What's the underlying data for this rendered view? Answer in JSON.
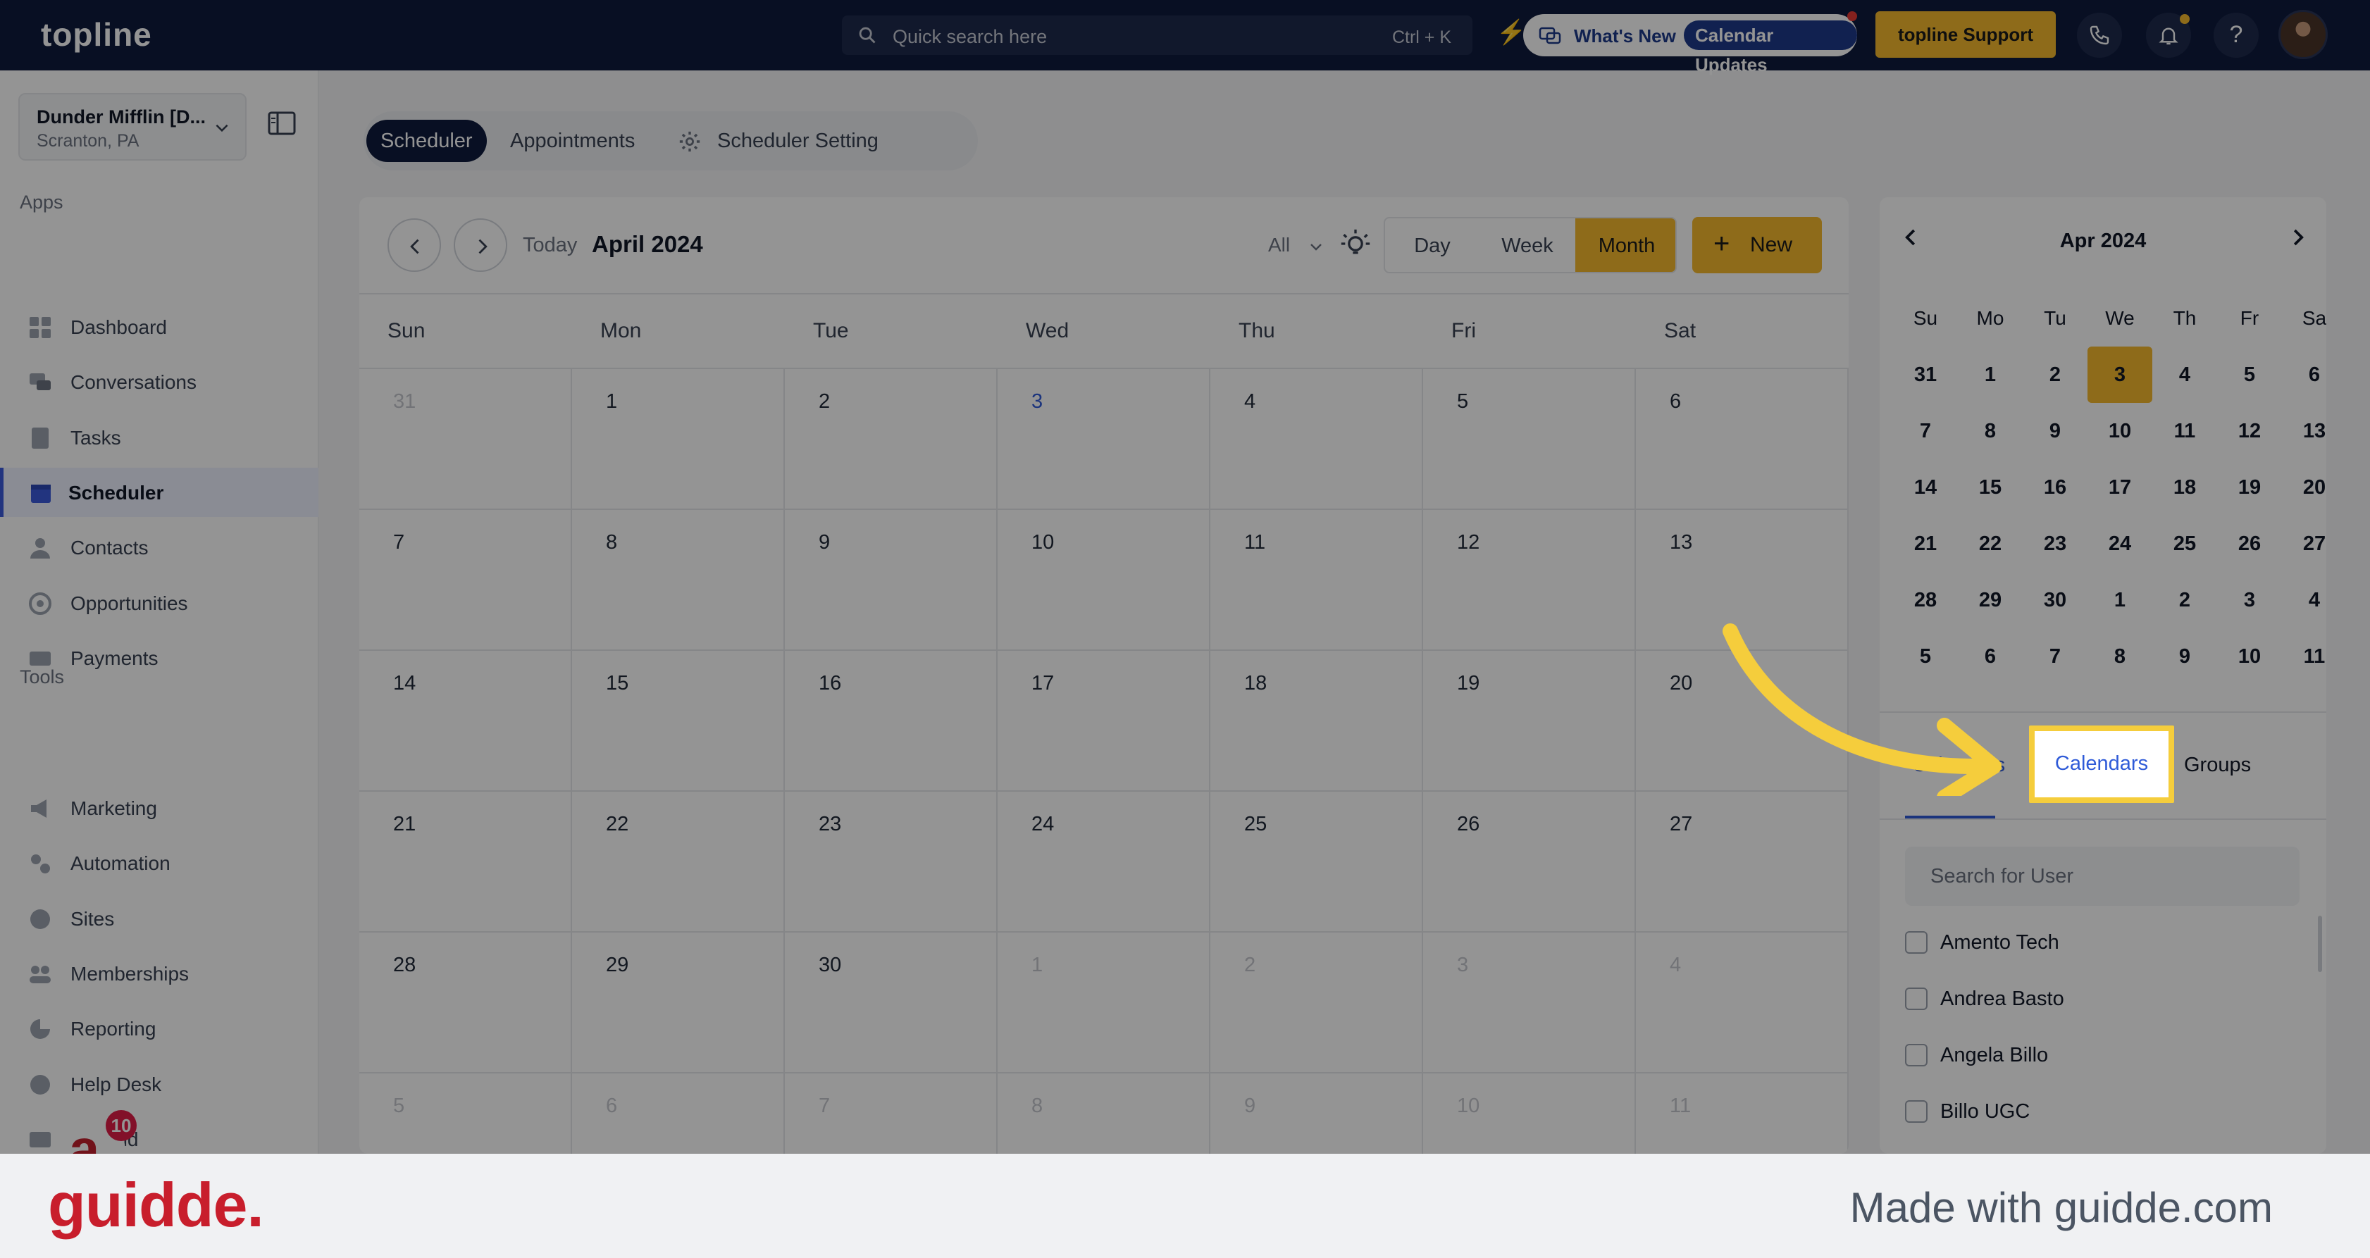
{
  "topbar": {
    "logo": "topline",
    "search_placeholder": "Quick search here",
    "search_shortcut": "Ctrl + K",
    "whats_new": "What's New",
    "calendar_updates": "Calendar Updates",
    "support": "topline Support"
  },
  "sidebar": {
    "location_name": "Dunder Mifflin [D...",
    "location_city": "Scranton, PA",
    "apps_heading": "Apps",
    "apps": [
      {
        "label": "Dashboard",
        "icon": "dashboard-icon"
      },
      {
        "label": "Conversations",
        "icon": "chat-icon"
      },
      {
        "label": "Tasks",
        "icon": "tasks-icon"
      },
      {
        "label": "Scheduler",
        "icon": "calendar-icon",
        "active": true
      },
      {
        "label": "Contacts",
        "icon": "person-icon"
      },
      {
        "label": "Opportunities",
        "icon": "target-icon"
      },
      {
        "label": "Payments",
        "icon": "card-icon"
      }
    ],
    "tools_heading": "Tools",
    "tools": [
      {
        "label": "Marketing",
        "icon": "megaphone-icon"
      },
      {
        "label": "Automation",
        "icon": "gears-icon"
      },
      {
        "label": "Sites",
        "icon": "globe-icon"
      },
      {
        "label": "Memberships",
        "icon": "users-icon"
      },
      {
        "label": "Reporting",
        "icon": "pie-icon"
      },
      {
        "label": "Help Desk",
        "icon": "help-icon"
      },
      {
        "label": "Mailfold",
        "icon": "mail-icon"
      }
    ],
    "badge_letter": "a",
    "badge_count": "10"
  },
  "main": {
    "tabs": [
      "Scheduler",
      "Appointments",
      "Scheduler Setting"
    ],
    "today": "Today",
    "month_title": "April 2024",
    "filter": "All",
    "views": [
      "Day",
      "Week",
      "Month"
    ],
    "active_view": "Month",
    "new_button": "New",
    "weekdays": [
      "Sun",
      "Mon",
      "Tue",
      "Wed",
      "Thu",
      "Fri",
      "Sat"
    ],
    "weeks": [
      [
        "31",
        "1",
        "2",
        "3",
        "4",
        "5",
        "6"
      ],
      [
        "7",
        "8",
        "9",
        "10",
        "11",
        "12",
        "13"
      ],
      [
        "14",
        "15",
        "16",
        "17",
        "18",
        "19",
        "20"
      ],
      [
        "21",
        "22",
        "23",
        "24",
        "25",
        "26",
        "27"
      ],
      [
        "28",
        "29",
        "30",
        "1",
        "2",
        "3",
        "4"
      ],
      [
        "5",
        "6",
        "7",
        "8",
        "9",
        "10",
        "11"
      ]
    ]
  },
  "mini_calendar": {
    "title": "Apr 2024",
    "weekdays": [
      "Su",
      "Mo",
      "Tu",
      "We",
      "Th",
      "Fr",
      "Sa"
    ],
    "weeks": [
      [
        "31",
        "1",
        "2",
        "3",
        "4",
        "5",
        "6"
      ],
      [
        "7",
        "8",
        "9",
        "10",
        "11",
        "12",
        "13"
      ],
      [
        "14",
        "15",
        "16",
        "17",
        "18",
        "19",
        "20"
      ],
      [
        "21",
        "22",
        "23",
        "24",
        "25",
        "26",
        "27"
      ],
      [
        "28",
        "29",
        "30",
        "1",
        "2",
        "3",
        "4"
      ],
      [
        "5",
        "6",
        "7",
        "8",
        "9",
        "10",
        "11"
      ]
    ],
    "selected": "3"
  },
  "user_panel": {
    "tabs": [
      "Calendars",
      "Groups"
    ],
    "search_placeholder": "Search for User",
    "users": [
      "Amento Tech",
      "Andrea Basto",
      "Angela Billo",
      "Billo UGC"
    ]
  },
  "footer": {
    "brand": "guidde.",
    "made_with": "Made with guidde.com"
  },
  "colors": {
    "navy": "#0f1b3d",
    "accent_gold": "#f4b82d",
    "highlight_yellow": "#f5cd3c",
    "link_blue": "#2f5bd8",
    "brand_red": "#c81e2c"
  }
}
